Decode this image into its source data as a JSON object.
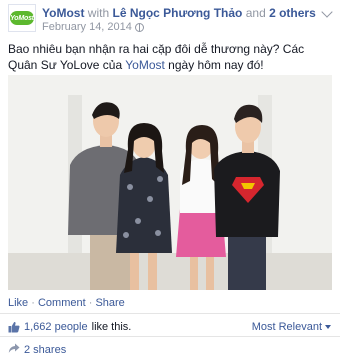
{
  "header": {
    "page_name": "YoMost",
    "with_text": "with",
    "tagged_person": "Lê Ngọc Phương Thảo",
    "and_text": "and",
    "others_link": "2 others",
    "date": "February 14, 2014",
    "avatar_logo_text": "YoMost"
  },
  "post": {
    "text_part1": "Bao nhiêu bạn nhận ra hai cặp đôi dễ thương này? Các Quân Sư YoLove của ",
    "mention": "YoMost",
    "text_part2": " ngày hôm nay đó!"
  },
  "actions": {
    "like": "Like",
    "sep1": " · ",
    "comment": "Comment",
    "sep2": " · ",
    "share": "Share"
  },
  "reactions": {
    "likes_link": "1,662 people",
    "likes_suffix": " like this.",
    "sort_label": "Most Relevant",
    "shares": "2 shares"
  },
  "icons": {
    "privacy": "globe-icon",
    "options": "chevron-down-icon",
    "like": "thumbs-up-icon",
    "share": "share-icon"
  },
  "colors": {
    "link": "#3b5998",
    "muted": "#9197a3",
    "brand_green": "#5cb82e"
  }
}
